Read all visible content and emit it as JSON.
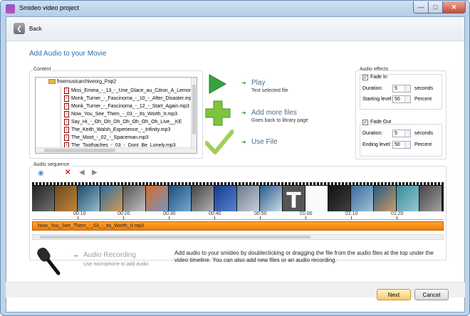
{
  "window": {
    "title": "Smideo video project",
    "minimize": "—",
    "maximize": "□",
    "close": "✕"
  },
  "nav": {
    "back_label": "Back"
  },
  "heading": "Add Audio to your Movie",
  "content": {
    "label": "Content",
    "root": "freemusicarchiveorg_Pop2",
    "files": [
      "Miss_Emma_-_13_-_Une_Glace_au_Citron_A_Lemon",
      "Monk_Turner_-_Fascinoma_-_10_-_After_Disaster.mp3",
      "Monk_Turner_-_Fascinoma_-_12_-_Start_Again.mp3",
      "Now_You_See_Them_-_03_-_Its_Worth_It.mp3",
      "Say_Hi_-_Oh_Oh_Oh_Oh_Oh_Oh_Oh_Live__KE",
      "The_Keith_Walsh_Experience_-_Infinity.mp3",
      "The_Moot_-_02_-_Spaceman.mp3",
      "The_Toothaches_-_03_-_Dont_Be_Lonely.mp3"
    ]
  },
  "actions": {
    "play": {
      "title": "Play",
      "sub": "Test selected file"
    },
    "add": {
      "title": "Add more files",
      "sub": "Goes back to library page"
    },
    "use": {
      "title": "Use File"
    }
  },
  "effects": {
    "label": "Audio effects",
    "fade_in": {
      "label": "Fade In",
      "checked": true,
      "duration_label": "Duration:",
      "duration": "5",
      "duration_unit": "seconds",
      "level_label": "Starting level:",
      "level": "50",
      "level_unit": "Percent"
    },
    "fade_out": {
      "label": "Fade Out",
      "checked": true,
      "duration_label": "Duration:",
      "duration": "5",
      "duration_unit": "seconds",
      "level_label": "Ending level:",
      "level": "50",
      "level_unit": "Percent"
    }
  },
  "sequence": {
    "label": "Audio sequence",
    "ticks": [
      "00:10",
      "00:20",
      "00:30",
      "00:40",
      "00:50",
      "01:00",
      "01:10",
      "01:20"
    ],
    "track": "Now_You_See_Them_-_03_-_Its_Worth_It.mp3",
    "letter_frame": "T"
  },
  "recording": {
    "title": "Audio Recording",
    "sub": "Use microphone to add audio"
  },
  "info": "Add audio to your smideo by doubleclicking or dragging the file from the audio files at the top under the video timeline. You can also add new files or an audio recording.",
  "footer": {
    "next": "Next",
    "cancel": "Cancel"
  },
  "colors": {
    "accent": "#2a6fb0",
    "track": "#f17a00",
    "play_green": "#2e9a3a"
  }
}
